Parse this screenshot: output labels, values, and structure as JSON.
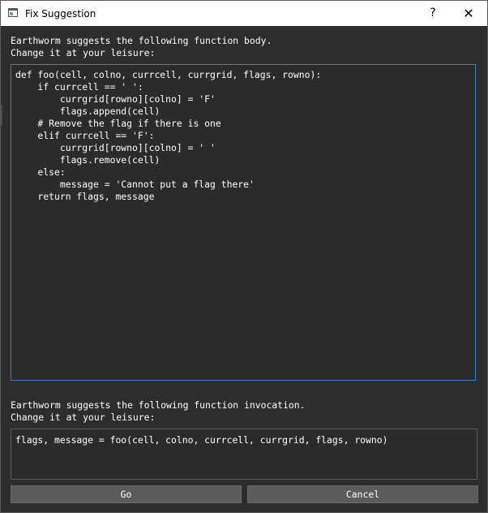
{
  "window": {
    "title": "Fix Suggestion",
    "help_glyph": "?",
    "close_glyph": "✕"
  },
  "body_section": {
    "label": "Earthworm suggests the following function body.\nChange it at your leisure:",
    "code": "def foo(cell, colno, currcell, currgrid, flags, rowno):\n    if currcell == ' ':\n        currgrid[rowno][colno] = 'F'\n        flags.append(cell)\n    # Remove the flag if there is one\n    elif currcell == 'F':\n        currgrid[rowno][colno] = ' '\n        flags.remove(cell)\n    else:\n        message = 'Cannot put a flag there'\n    return flags, message"
  },
  "invocation_section": {
    "label": "Earthworm suggests the following function invocation.\nChange it at your leisure:",
    "code": "flags, message = foo(cell, colno, currcell, currgrid, flags, rowno)"
  },
  "buttons": {
    "go": "Go",
    "cancel": "Cancel"
  },
  "colors": {
    "background": "#2d2d2d",
    "editor_focus_border": "#3d7fc4",
    "button": "#5b5b5b",
    "text": "#ffffff"
  },
  "icons": {
    "title": "window-icon",
    "help": "help-icon",
    "close": "close-icon"
  }
}
